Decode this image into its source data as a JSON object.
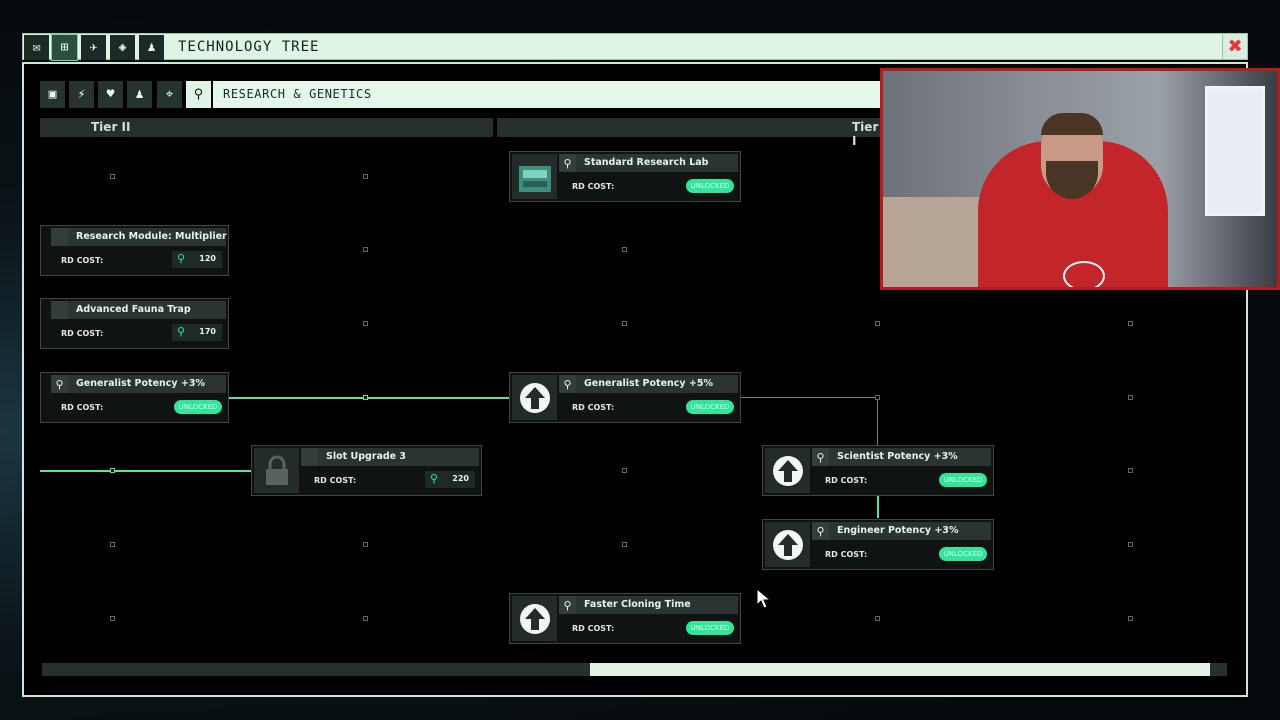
{
  "window": {
    "title": "TECHNOLOGY TREE",
    "tabs": [
      "mail-icon",
      "tech-tree-icon",
      "satellite-icon",
      "waypoint-icon",
      "crew-icon"
    ],
    "close_icon": "close-icon"
  },
  "toolbar": {
    "filters": [
      "cube-icon",
      "power-icon",
      "heart-icon",
      "crew-icon",
      "location-icon",
      "search-icon"
    ],
    "category": "RESEARCH & GENETICS"
  },
  "tiers": [
    "Tier II",
    "Tier I"
  ],
  "nodes": {
    "standard_research_lab": {
      "name": "Standard Research Lab",
      "cost_label": "RD COST:",
      "status": "UNLOCKED"
    },
    "research_module_multiplier": {
      "name": "Research Module: Multiplier",
      "cost_label": "RD COST:",
      "cost": "120"
    },
    "advanced_fauna_trap": {
      "name": "Advanced Fauna Trap",
      "cost_label": "RD COST:",
      "cost": "170"
    },
    "generalist_potency_3": {
      "name": "Generalist Potency +3%",
      "cost_label": "RD COST:",
      "status": "UNLOCKED"
    },
    "generalist_potency_5": {
      "name": "Generalist Potency +5%",
      "cost_label": "RD COST:",
      "status": "UNLOCKED"
    },
    "slot_upgrade_3": {
      "name": "Slot Upgrade 3",
      "cost_label": "RD COST:",
      "cost": "220"
    },
    "scientist_potency_3": {
      "name": "Scientist Potency +3%",
      "cost_label": "RD COST:",
      "status": "UNLOCKED"
    },
    "engineer_potency_3": {
      "name": "Engineer Potency +3%",
      "cost_label": "RD COST:",
      "status": "UNLOCKED"
    },
    "faster_cloning_time": {
      "name": "Faster Cloning Time",
      "cost_label": "RD COST:",
      "status": "UNLOCKED"
    }
  },
  "colors": {
    "accent": "#2fe69a",
    "frame": "#dff4e4",
    "close": "#e8373d"
  }
}
